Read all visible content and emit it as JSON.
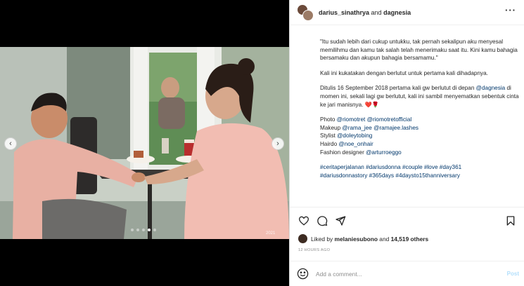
{
  "header": {
    "user1": "darius_sinathrya",
    "and_text": "and",
    "user2": "dagnesia",
    "more_icon": "more-horizontal-icon"
  },
  "media": {
    "prev_icon": "chevron-left-icon",
    "next_icon": "chevron-right-icon",
    "watermark": "2021"
  },
  "caption": {
    "p1": "\"Itu sudah lebih dari cukup untukku, tak pernah sekalipun aku menyesal memilihmu dan kamu tak salah telah menerimaku saat itu. Kini kamu bahagia bersamaku dan akupun bahagia bersamamu.\"",
    "p2": "Kali ini kukatakan dengan berlutut untuk pertama kali dihadapnya.",
    "p3_before": "Ditulis 16 September 2018 pertama kali gw berlutut di depan ",
    "p3_mention": "@dagnesia",
    "p3_after": " di momen ini, sekali lagi gw berlutut, kali ini sambil menyematkan sebentuk cinta ke jari manisnya. ",
    "p3_emoji": "❤️🌹",
    "photo_label": "Photo ",
    "photo_m1": "@riomotret",
    "photo_m2": "@riomotretofficial",
    "makeup_label": "Makeup ",
    "makeup_m1": "@rama_jee",
    "makeup_m2": "@ramajee.lashes",
    "stylist_label": "Stylist ",
    "stylist_m": "@doleytobing",
    "hairdo_label": "Hairdo ",
    "hairdo_m": "@noe_onhair",
    "fashion_label": "Fashion designer ",
    "fashion_m": "@arturroeggo",
    "hashtags1": "#ceritaperjalanan #dariusdonna #couple #love #day361",
    "hashtags2": "#dariusdonnastory #365days #4daysto15thanniversary"
  },
  "actions": {
    "like_icon": "heart-icon",
    "comment_icon": "comment-icon",
    "share_icon": "share-icon",
    "save_icon": "bookmark-icon"
  },
  "likes": {
    "prefix": "Liked by ",
    "user": "melaniesubono",
    "middle": " and ",
    "count": "14,519 others"
  },
  "timestamp": "12 HOURS AGO",
  "comment": {
    "placeholder": "Add a comment...",
    "post_label": "Post",
    "emoji_icon": "smile-icon"
  },
  "colors": {
    "link": "#00376b",
    "post_disabled": "#b2dffc",
    "muted": "#8e8e8e"
  }
}
